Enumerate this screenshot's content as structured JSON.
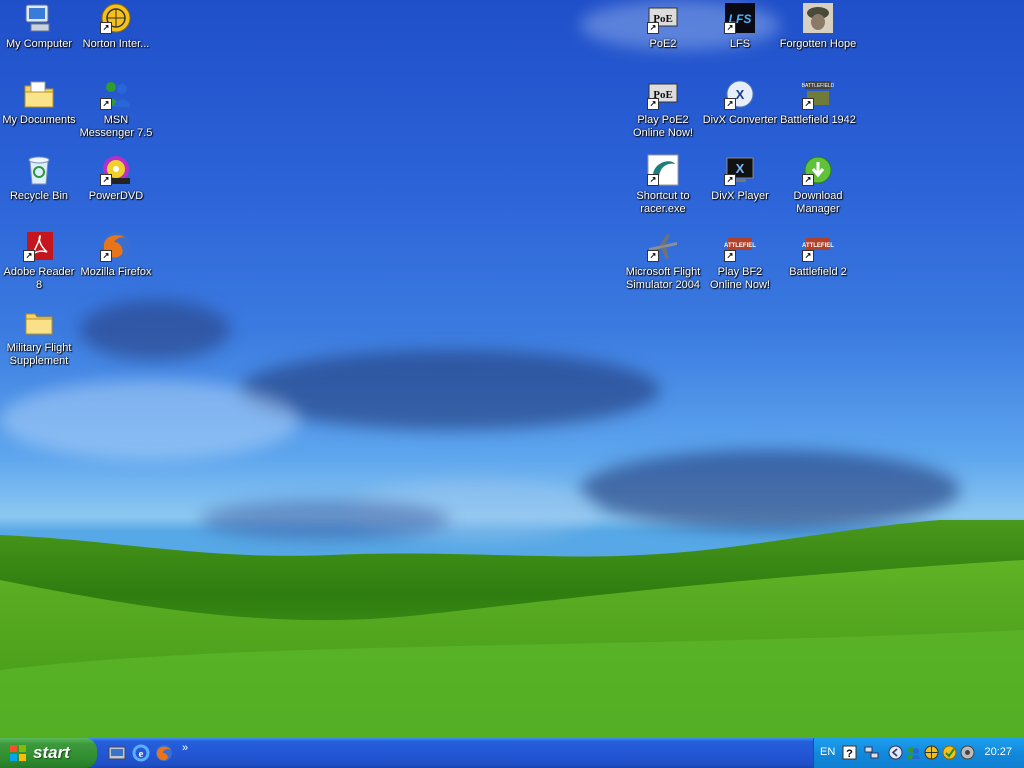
{
  "desktop": {
    "icons": [
      {
        "id": "my-computer",
        "label": "My Computer"
      },
      {
        "id": "norton",
        "label": "Norton Inter..."
      },
      {
        "id": "my-documents",
        "label": "My Documents"
      },
      {
        "id": "msn",
        "label": "MSN Messenger 7.5"
      },
      {
        "id": "recycle-bin",
        "label": "Recycle Bin"
      },
      {
        "id": "powerdvd",
        "label": "PowerDVD"
      },
      {
        "id": "adobe-reader",
        "label": "Adobe Reader 8"
      },
      {
        "id": "firefox",
        "label": "Mozilla Firefox"
      },
      {
        "id": "military-flight",
        "label": "Military Flight Supplement"
      },
      {
        "id": "poe2",
        "label": "PoE2"
      },
      {
        "id": "lfs",
        "label": "LFS"
      },
      {
        "id": "forgotten-hope",
        "label": "Forgotten Hope"
      },
      {
        "id": "play-poe2",
        "label": "Play PoE2 Online Now!"
      },
      {
        "id": "divx-converter",
        "label": "DivX Converter"
      },
      {
        "id": "battlefield-1942",
        "label": "Battlefield 1942"
      },
      {
        "id": "racer",
        "label": "Shortcut to racer.exe"
      },
      {
        "id": "divx-player",
        "label": "DivX Player"
      },
      {
        "id": "download-manager",
        "label": "Download Manager"
      },
      {
        "id": "flight-sim",
        "label": "Microsoft Flight Simulator 2004"
      },
      {
        "id": "play-bf2",
        "label": "Play BF2 Online Now!"
      },
      {
        "id": "battlefield-2",
        "label": "Battlefield 2"
      }
    ]
  },
  "taskbar": {
    "start_label": "start",
    "quick_launch": [
      "show-desktop-icon",
      "internet-explorer-icon",
      "firefox-icon"
    ],
    "overflow_chevron": "»",
    "tray": {
      "language": "EN",
      "clock": "20:27",
      "icons": [
        "help-icon",
        "network-icon",
        "back-icon",
        "msn-icon",
        "globe-icon",
        "norton-icon",
        "volume-icon"
      ]
    }
  },
  "colors": {
    "taskbar_blue": "#245edb",
    "start_green": "#3c9a3c",
    "tray_blue": "#1289dc"
  }
}
